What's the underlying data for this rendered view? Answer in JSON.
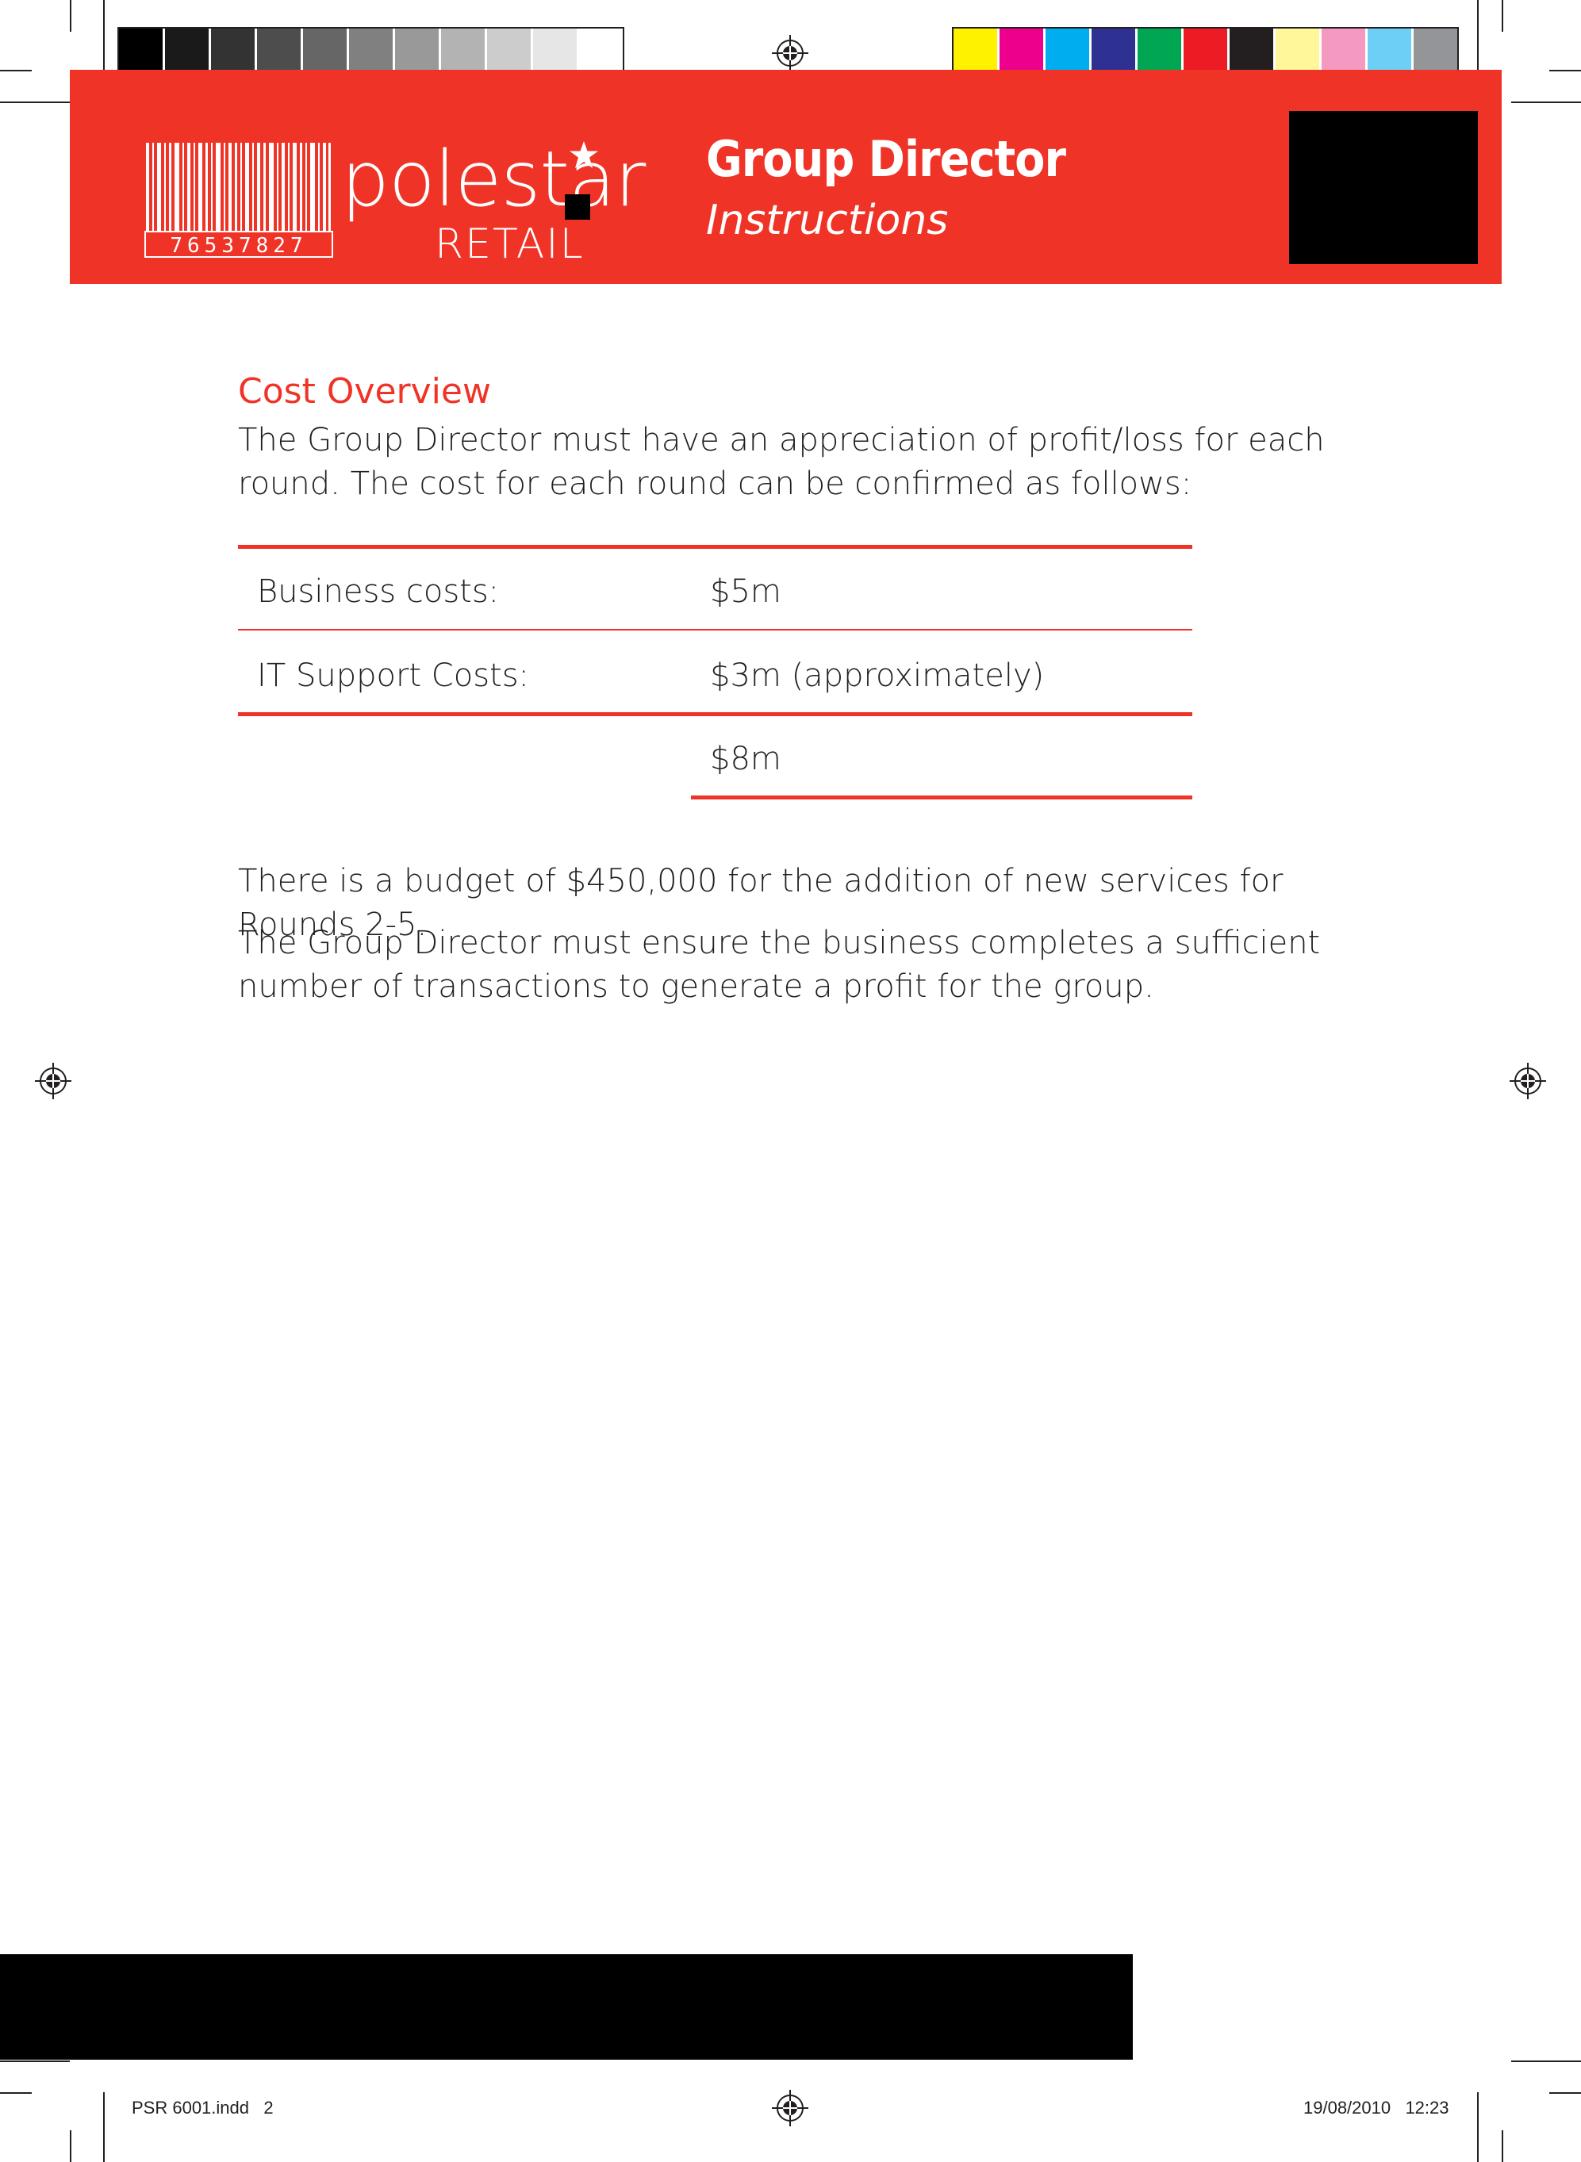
{
  "header": {
    "logo": {
      "barcode_digits": "76537827",
      "wordmark": "polestar",
      "sub_wordmark": "RETAIL"
    },
    "title": "Group Director",
    "subtitle": "Instructions"
  },
  "printer_marks": {
    "grayscale_swatches": [
      "#000000",
      "#1a1a1a",
      "#333333",
      "#4d4d4d",
      "#666666",
      "#808080",
      "#999999",
      "#b3b3b3",
      "#cccccc",
      "#e6e6e6",
      "#ffffff"
    ],
    "color_swatches": [
      "#fff200",
      "#ec008c",
      "#00aeef",
      "#2e3192",
      "#00a651",
      "#ed1c24",
      "#231f20",
      "#fff799",
      "#f49ac1",
      "#6dcff6",
      "#939598"
    ]
  },
  "content": {
    "heading": "Cost Overview",
    "intro": "The Group Director must have an appreciation of profit/loss for each round. The cost for each round can be confirmed as follows:",
    "cost_table": {
      "rows": [
        {
          "label": "Business costs:",
          "value": "$5m"
        },
        {
          "label": "IT Support Costs:",
          "value": "$3m (approximately)"
        }
      ],
      "total": "$8m"
    },
    "paragraphs": [
      "There is a budget of $450,000 for the addition of new services for Rounds 2-5.",
      "The Group Director must ensure the business completes a sufficient number of transactions to generate a profit for the group."
    ]
  },
  "slug": {
    "file": "PSR 6001.indd   2",
    "date": "19/08/2010   12:23"
  },
  "colors": {
    "brand_red": "#ef3427",
    "text": "#231f20"
  }
}
